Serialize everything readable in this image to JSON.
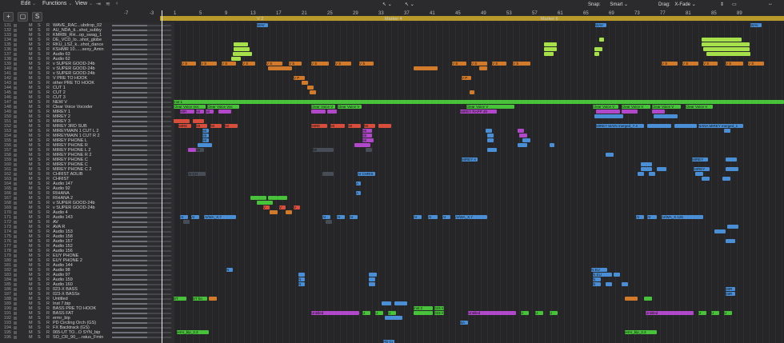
{
  "menus": {
    "edit": "Edit",
    "functions": "Functions",
    "view": "View"
  },
  "ruler": {
    "ticks": [
      "-7",
      "-3",
      "1",
      "5",
      "9",
      "13",
      "17",
      "21",
      "25",
      "29",
      "33",
      "37",
      "41",
      "45",
      "49",
      "53",
      "57",
      "61",
      "65",
      "69",
      "73",
      "77",
      "81",
      "85",
      "89"
    ]
  },
  "snap": {
    "label": "Snap:",
    "value": "Smart"
  },
  "drag": {
    "label": "Drag:",
    "value": "X-Fade"
  },
  "markers": [
    "V 2",
    "Marker 4",
    "Marker 6"
  ],
  "wav_labels": [
    "WAV",
    "WAV",
    "WAV"
  ],
  "header_buttons": {
    "add": "+",
    "s": "S"
  },
  "track_controls": {
    "mute": "M",
    "solo": "S",
    "rec": "R"
  },
  "tracks": [
    {
      "n": "131",
      "name": "WAVE_RAC...ubdrop_02"
    },
    {
      "n": "132",
      "name": "AU_NDA_ti...shot_subby"
    },
    {
      "n": "133",
      "name": "KMRBI_RH...op_swag_1"
    },
    {
      "n": "134",
      "name": "DE_VCD_lo...shot_globe"
    },
    {
      "n": "135",
      "name": "RKU_LS2_k...shot_dance"
    },
    {
      "n": "136",
      "name": "KSHMR 10......sexy_Amin"
    },
    {
      "n": "137",
      "name": "Audio 63"
    },
    {
      "n": "138",
      "name": "Audio 62"
    },
    {
      "n": "139",
      "name": "v SUPER GOOD-24b"
    },
    {
      "n": "140",
      "name": "v SUPER GOOD-24b"
    },
    {
      "n": "141",
      "name": "v SUPER GOOD-24b"
    },
    {
      "n": "142",
      "name": "V PRE TO HOOK"
    },
    {
      "n": "143",
      "name": "other PRE TO HOOK"
    },
    {
      "n": "144",
      "name": "CUT 1"
    },
    {
      "n": "145",
      "name": "CUT 2"
    },
    {
      "n": "146",
      "name": "CUT 3"
    },
    {
      "n": "147",
      "name": "NEW V"
    },
    {
      "n": "148",
      "name": "Clear Voice Vocoder"
    },
    {
      "n": "149",
      "name": "MIREY 1"
    },
    {
      "n": "150",
      "name": "MIREY 2"
    },
    {
      "n": "151",
      "name": "MIREY 3"
    },
    {
      "n": "152",
      "name": "MIREY 3RD SUB"
    },
    {
      "n": "153",
      "name": "MIREYMAIN 1 CUT L 2"
    },
    {
      "n": "154",
      "name": "MIREYMAIN 1 CUT R 2"
    },
    {
      "n": "155",
      "name": "MIREY PHONE L"
    },
    {
      "n": "156",
      "name": "MIREY PHONE R"
    },
    {
      "n": "157",
      "name": "MIREY PHONE L 2"
    },
    {
      "n": "158",
      "name": "MIREY PHONE R 2"
    },
    {
      "n": "159",
      "name": "MIREY PHONE C"
    },
    {
      "n": "160",
      "name": "MIREY PHONE C"
    },
    {
      "n": "161",
      "name": "MIREY PHONE C 2"
    },
    {
      "n": "162",
      "name": "CHRIST ADLIB"
    },
    {
      "n": "163",
      "name": "CHRIST"
    },
    {
      "n": "164",
      "name": "Audio 147"
    },
    {
      "n": "165",
      "name": "Audio 92"
    },
    {
      "n": "166",
      "name": "RIHANA"
    },
    {
      "n": "167",
      "name": "RIHANA 2"
    },
    {
      "n": "168",
      "name": "v SUPER GOOD-24b"
    },
    {
      "n": "169",
      "name": "v SUPER GOOD-24b"
    },
    {
      "n": "170",
      "name": "Audio 4"
    },
    {
      "n": "171",
      "name": "Audio 143"
    },
    {
      "n": "172",
      "name": "AV"
    },
    {
      "n": "173",
      "name": "AVA R"
    },
    {
      "n": "174",
      "name": "Audio 153"
    },
    {
      "n": "175",
      "name": "Audio 158"
    },
    {
      "n": "176",
      "name": "Audio 157"
    },
    {
      "n": "177",
      "name": "Audio 152"
    },
    {
      "n": "178",
      "name": "Audio 156"
    },
    {
      "n": "179",
      "name": "EUY PHONE"
    },
    {
      "n": "180",
      "name": "EUY PHONE 2"
    },
    {
      "n": "181",
      "name": "Audio 144"
    },
    {
      "n": "182",
      "name": "Audio 98"
    },
    {
      "n": "183",
      "name": "Audio 97"
    },
    {
      "n": "184",
      "name": "Audio 159"
    },
    {
      "n": "185",
      "name": "Audio 160"
    },
    {
      "n": "186",
      "name": "023-X BASS"
    },
    {
      "n": "187",
      "name": "023-X BASSx"
    },
    {
      "n": "188",
      "name": "Untitled"
    },
    {
      "n": "189",
      "name": "Inst 7.bip"
    },
    {
      "n": "190",
      "name": "BASS PRE TO HOOK"
    },
    {
      "n": "191",
      "name": "BASS FAT"
    },
    {
      "n": "192",
      "name": "ermr_bip"
    },
    {
      "n": "193",
      "name": "PD Circling Orch (GS)"
    },
    {
      "n": "194",
      "name": "FX Backtrack (GS)"
    },
    {
      "n": "195",
      "name": "065-UT TO...O SYN_bip"
    },
    {
      "n": "196",
      "name": "SO_CR_90_...ratus_Fmin"
    }
  ],
  "region_labels": {
    "vs": "V S",
    "vp": "V P",
    "inst1": "Inst 1",
    "clear": "Clear Voice Voc",
    "clear2": "Clear Voice V",
    "mir": "MIR",
    "mi": "MI",
    "mire": "MIRE",
    "mirey_rapp": "MIREY RAPP 49",
    "mirey_main": "MIREY MAIN merged_7.4",
    "nana": "NANA MIREY merged_1",
    "mirey_a": "MIREY A",
    "ai_ch": "AI CH",
    "ai_chris": "AI CHRIS",
    "mirey": "MIREY",
    "a": "A",
    "v": "V",
    "ai": "AI",
    "aiwa": "AI/WA_X.7",
    "aiwa125": "AI/WA_X.125",
    "n": "N",
    "neu": "N EU",
    "mir2": "MIR",
    "bt": "BT",
    "btbo": "BT bo",
    "inst2": "Inst 2",
    "bass": "023-X B",
    "untitled": "Untitled",
    "u": "U",
    "ba": "BA",
    "ermr": "ermr_bip_3.3",
    "pd": "PD Ci",
    "fx": "FX Backtrack",
    "ut": "065-UT"
  }
}
